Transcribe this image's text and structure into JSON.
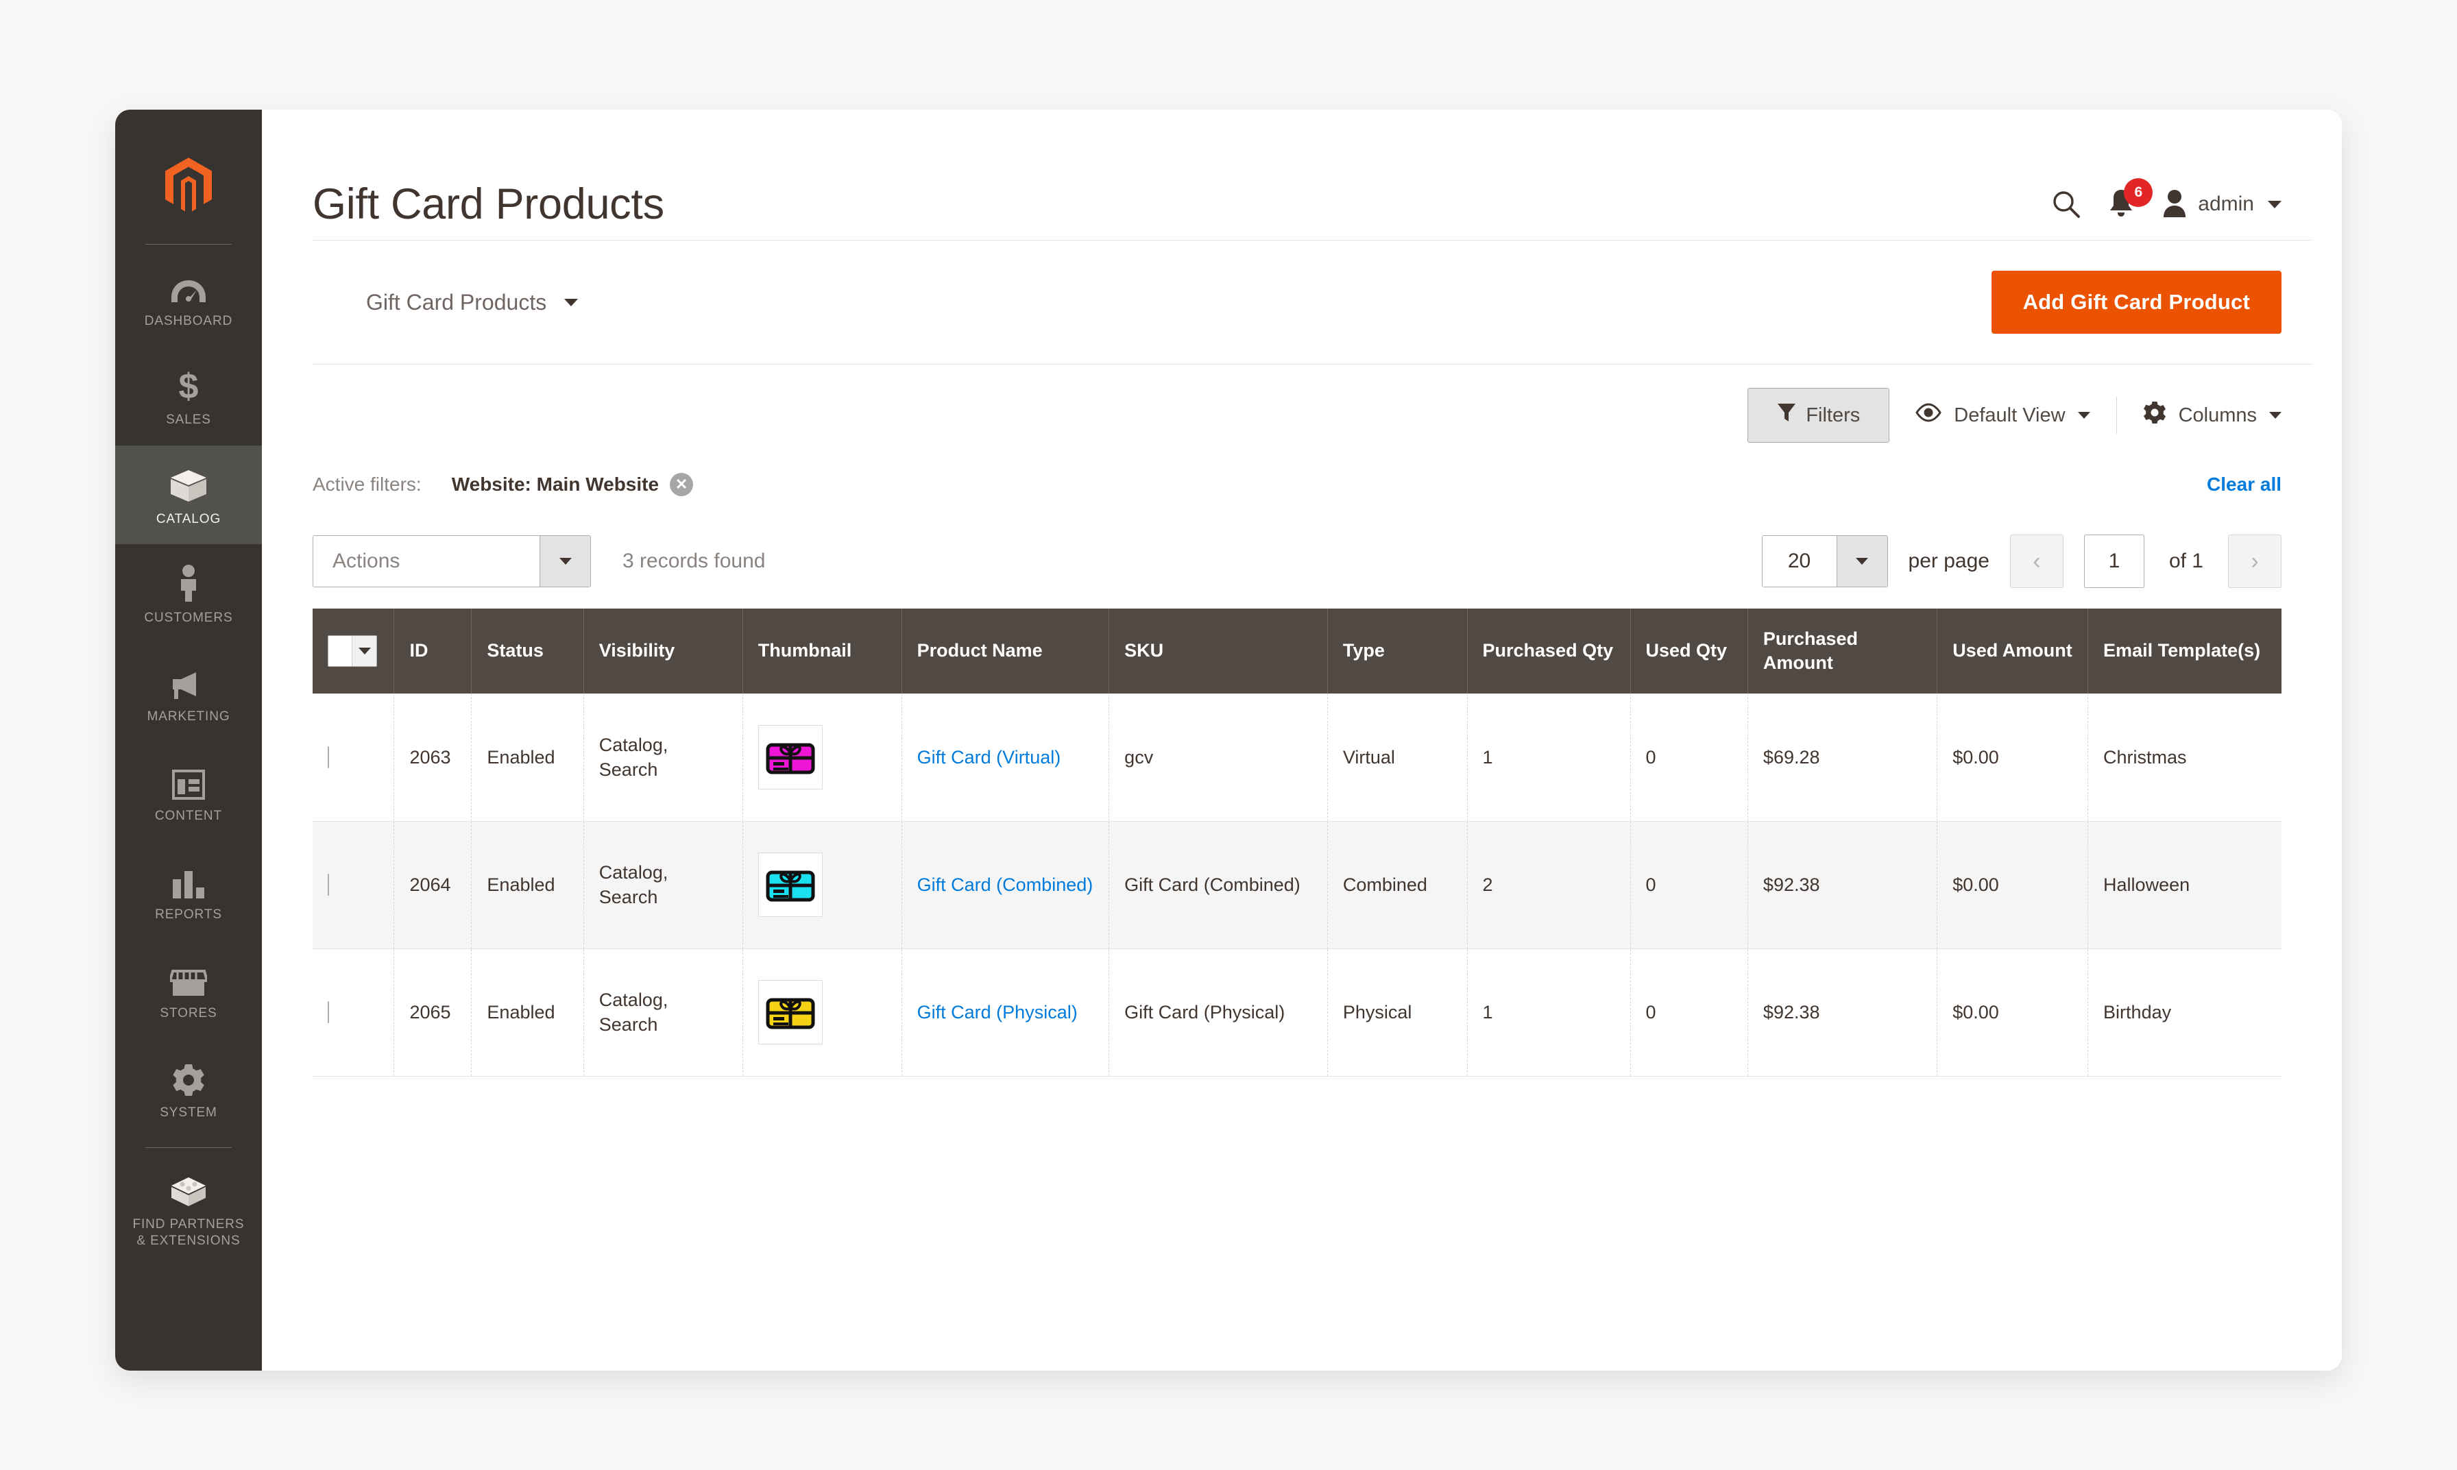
{
  "sidebar": {
    "logo_icon": "magento-logo-icon",
    "items": [
      {
        "id": "dashboard",
        "label": "DASHBOARD",
        "icon": "gauge-icon",
        "active": false
      },
      {
        "id": "sales",
        "label": "SALES",
        "icon": "dollar-icon",
        "active": false
      },
      {
        "id": "catalog",
        "label": "CATALOG",
        "icon": "box-icon",
        "active": true
      },
      {
        "id": "customers",
        "label": "CUSTOMERS",
        "icon": "person-icon",
        "active": false
      },
      {
        "id": "marketing",
        "label": "MARKETING",
        "icon": "megaphone-icon",
        "active": false
      },
      {
        "id": "content",
        "label": "CONTENT",
        "icon": "layout-icon",
        "active": false
      },
      {
        "id": "reports",
        "label": "REPORTS",
        "icon": "bar-chart-icon",
        "active": false
      },
      {
        "id": "stores",
        "label": "STORES",
        "icon": "storefront-icon",
        "active": false
      },
      {
        "id": "system",
        "label": "SYSTEM",
        "icon": "gear-icon",
        "active": false
      },
      {
        "id": "find-partners",
        "label": "FIND PARTNERS\n& EXTENSIONS",
        "icon": "extension-block-icon",
        "active": false
      }
    ]
  },
  "header": {
    "title": "Gift Card Products",
    "search_icon": "search-icon",
    "notifications": {
      "icon": "bell-icon",
      "count": "6"
    },
    "user": {
      "icon": "user-avatar-icon",
      "name": "admin",
      "caret": "chevron-down-icon"
    }
  },
  "toolbar": {
    "view_switcher_label": "Gift Card Products",
    "view_switcher_caret": "chevron-down-icon",
    "add_button_label": "Add Gift Card Product"
  },
  "grid_controls": {
    "filters_label": "Filters",
    "filters_icon": "funnel-icon",
    "view_label": "Default View",
    "view_icon": "eye-icon",
    "columns_label": "Columns",
    "columns_icon": "gear-icon"
  },
  "active_filters": {
    "label": "Active filters:",
    "chips": [
      {
        "text": "Website: Main Website",
        "remove_icon": "close-circle-icon"
      }
    ],
    "clear_all_label": "Clear all"
  },
  "actions_row": {
    "actions_label": "Actions",
    "actions_caret": "chevron-down-icon",
    "records_found": "3 records found",
    "per_page_value": "20",
    "per_page_caret": "chevron-down-icon",
    "per_page_label": "per page",
    "prev_icon": "chevron-left-icon",
    "next_icon": "chevron-right-icon",
    "page_value": "1",
    "page_of": "of 1"
  },
  "table": {
    "select_all_icon": "checkbox-dropdown-icon",
    "columns": [
      {
        "key": "select",
        "label": ""
      },
      {
        "key": "id",
        "label": "ID"
      },
      {
        "key": "status",
        "label": "Status"
      },
      {
        "key": "visibility",
        "label": "Visibility"
      },
      {
        "key": "thumbnail",
        "label": "Thumbnail"
      },
      {
        "key": "product_name",
        "label": "Product Name"
      },
      {
        "key": "sku",
        "label": "SKU"
      },
      {
        "key": "type",
        "label": "Type"
      },
      {
        "key": "purchased_qty",
        "label": "Purchased Qty"
      },
      {
        "key": "used_qty",
        "label": "Used Qty"
      },
      {
        "key": "purchased_amount",
        "label": "Purchased Amount"
      },
      {
        "key": "used_amount",
        "label": "Used Amount"
      },
      {
        "key": "email_templates",
        "label": "Email Template(s)"
      }
    ],
    "rows": [
      {
        "id": "2063",
        "status": "Enabled",
        "visibility": "Catalog, Search",
        "thumbnail_color": "#ef15d6",
        "thumbnail_icon": "gift-card-icon",
        "product_name": "Gift Card (Virtual)",
        "sku": "gcv",
        "type": "Virtual",
        "purchased_qty": "1",
        "used_qty": "0",
        "purchased_amount": "$69.28",
        "used_amount": "$0.00",
        "email_templates": "Christmas"
      },
      {
        "id": "2064",
        "status": "Enabled",
        "visibility": "Catalog, Search",
        "thumbnail_color": "#1ae0ef",
        "thumbnail_icon": "gift-card-icon",
        "product_name": "Gift Card (Combined)",
        "sku": "Gift Card (Combined)",
        "type": "Combined",
        "purchased_qty": "2",
        "used_qty": "0",
        "purchased_amount": "$92.38",
        "used_amount": "$0.00",
        "email_templates": "Halloween"
      },
      {
        "id": "2065",
        "status": "Enabled",
        "visibility": "Catalog, Search",
        "thumbnail_color": "#f5d314",
        "thumbnail_icon": "gift-card-icon",
        "product_name": "Gift Card (Physical)",
        "sku": "Gift Card (Physical)",
        "type": "Physical",
        "purchased_qty": "1",
        "used_qty": "0",
        "purchased_amount": "$92.38",
        "used_amount": "$0.00",
        "email_templates": "Birthday"
      }
    ]
  },
  "colors": {
    "brand_orange": "#eb5202",
    "sidebar_bg": "#373330",
    "table_header_bg": "#514943",
    "link_blue": "#007bdb",
    "badge_red": "#e22626"
  }
}
